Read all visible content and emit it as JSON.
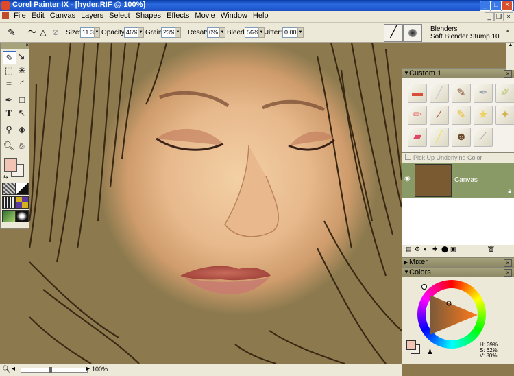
{
  "window": {
    "title": "Corel Painter IX - [hyder.RIF @ 100%]",
    "buttons": [
      "_",
      "□",
      "×"
    ]
  },
  "menu": [
    "File",
    "Edit",
    "Canvas",
    "Layers",
    "Select",
    "Shapes",
    "Effects",
    "Movie",
    "Window",
    "Help"
  ],
  "property_bar": {
    "size_label": "Size:",
    "size_value": "11.3",
    "opacity_label": "Opacity:",
    "opacity_value": "46%",
    "grain_label": "Grain:",
    "grain_value": "23%",
    "resat_label": "Resat:",
    "resat_value": "0%",
    "bleed_label": "Bleed:",
    "bleed_value": "56%",
    "jitter_label": "Jitter:",
    "jitter_value": "0.00"
  },
  "brush_selector": {
    "category": "Blenders",
    "variant": "Soft Blender Stump 10"
  },
  "custom_palette": {
    "title": "Custom 1",
    "variant_icons": [
      "eraser-brush-icon",
      "pencil-brush-icon",
      "oil-brush-icon",
      "airbrush-icon",
      "marker-icon",
      "pastel-icon",
      "chalk-icon",
      "crayon-icon",
      "star-icon",
      "gold-brush-icon",
      "red-eraser-icon",
      "yellow-pen-icon",
      "portrait-icon",
      "palette-knife-icon"
    ]
  },
  "layers": {
    "pick_up_label": "Pick Up Underlying Color",
    "items": [
      {
        "name": "Canvas"
      }
    ]
  },
  "mixer": {
    "title": "Mixer"
  },
  "colors": {
    "title": "Colors",
    "h": "H: 39%",
    "s": "S: 62%",
    "v": "V: 80%",
    "main_color": "#f2c4b4",
    "secondary_color": "#f4f0e8"
  },
  "status": {
    "zoom": "100%"
  }
}
